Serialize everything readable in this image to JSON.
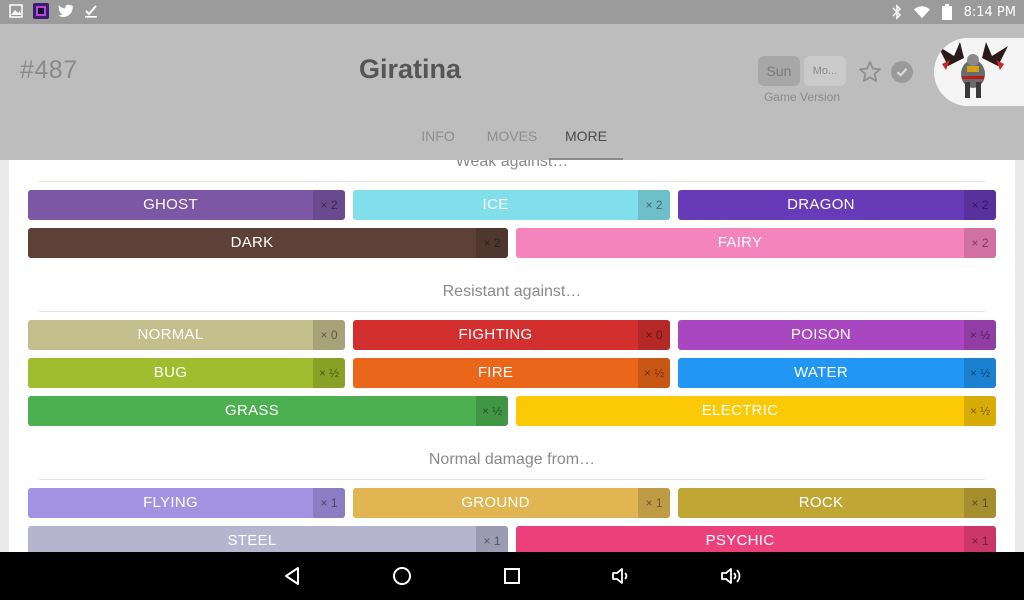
{
  "status_bar": {
    "left_icons": [
      "image-icon",
      "app-icon",
      "twitter-icon",
      "task-check-icon"
    ],
    "right_icons": [
      "bluetooth-icon",
      "wifi-icon",
      "battery-icon"
    ],
    "time": "8:14 PM"
  },
  "header": {
    "dex_number": "#487",
    "pokemon_name": "Giratina",
    "game_version": {
      "options": [
        "Sun",
        "Mo..."
      ],
      "selected": "Sun",
      "label": "Game Version"
    },
    "icons": [
      "star-icon",
      "check-circle-icon",
      "pokemon-avatar"
    ],
    "tabs": [
      {
        "label": "INFO",
        "active": false
      },
      {
        "label": "MOVES",
        "active": false
      },
      {
        "label": "MORE",
        "active": true
      }
    ]
  },
  "sections": {
    "weak": {
      "title": "Weak against…",
      "items": [
        {
          "type": "GHOST",
          "mult": "× 2",
          "color": "#7b57a6"
        },
        {
          "type": "ICE",
          "mult": "× 2",
          "color": "#80dfea"
        },
        {
          "type": "DRAGON",
          "mult": "× 2",
          "color": "#673ab7"
        },
        {
          "type": "DARK",
          "mult": "× 2",
          "color": "#5d4037"
        },
        {
          "type": "FAIRY",
          "mult": "× 2",
          "color": "#f484bc"
        }
      ]
    },
    "resistant": {
      "title": "Resistant against…",
      "items": [
        {
          "type": "NORMAL",
          "mult": "× 0",
          "color": "#c4bd8c"
        },
        {
          "type": "FIGHTING",
          "mult": "× 0",
          "color": "#d32f2f"
        },
        {
          "type": "POISON",
          "mult": "× ½",
          "color": "#a947c0"
        },
        {
          "type": "BUG",
          "mult": "× ½",
          "color": "#9fbd2e"
        },
        {
          "type": "FIRE",
          "mult": "× ½",
          "color": "#e9661a"
        },
        {
          "type": "WATER",
          "mult": "× ½",
          "color": "#2196f3"
        },
        {
          "type": "GRASS",
          "mult": "× ½",
          "color": "#4caf50"
        },
        {
          "type": "ELECTRIC",
          "mult": "× ½",
          "color": "#fcc907"
        }
      ]
    },
    "normal": {
      "title": "Normal damage from…",
      "items": [
        {
          "type": "FLYING",
          "mult": "× 1",
          "color": "#a292e2"
        },
        {
          "type": "GROUND",
          "mult": "× 1",
          "color": "#e0b552"
        },
        {
          "type": "ROCK",
          "mult": "× 1",
          "color": "#bfa635"
        },
        {
          "type": "STEEL",
          "mult": "× 1",
          "color": "#b5b5cf"
        },
        {
          "type": "PSYCHIC",
          "mult": "× 1",
          "color": "#ec407a"
        }
      ]
    }
  },
  "nav_bar": {
    "icons": [
      "back-icon",
      "home-icon",
      "recents-icon",
      "volume-down-icon",
      "volume-up-icon"
    ]
  }
}
